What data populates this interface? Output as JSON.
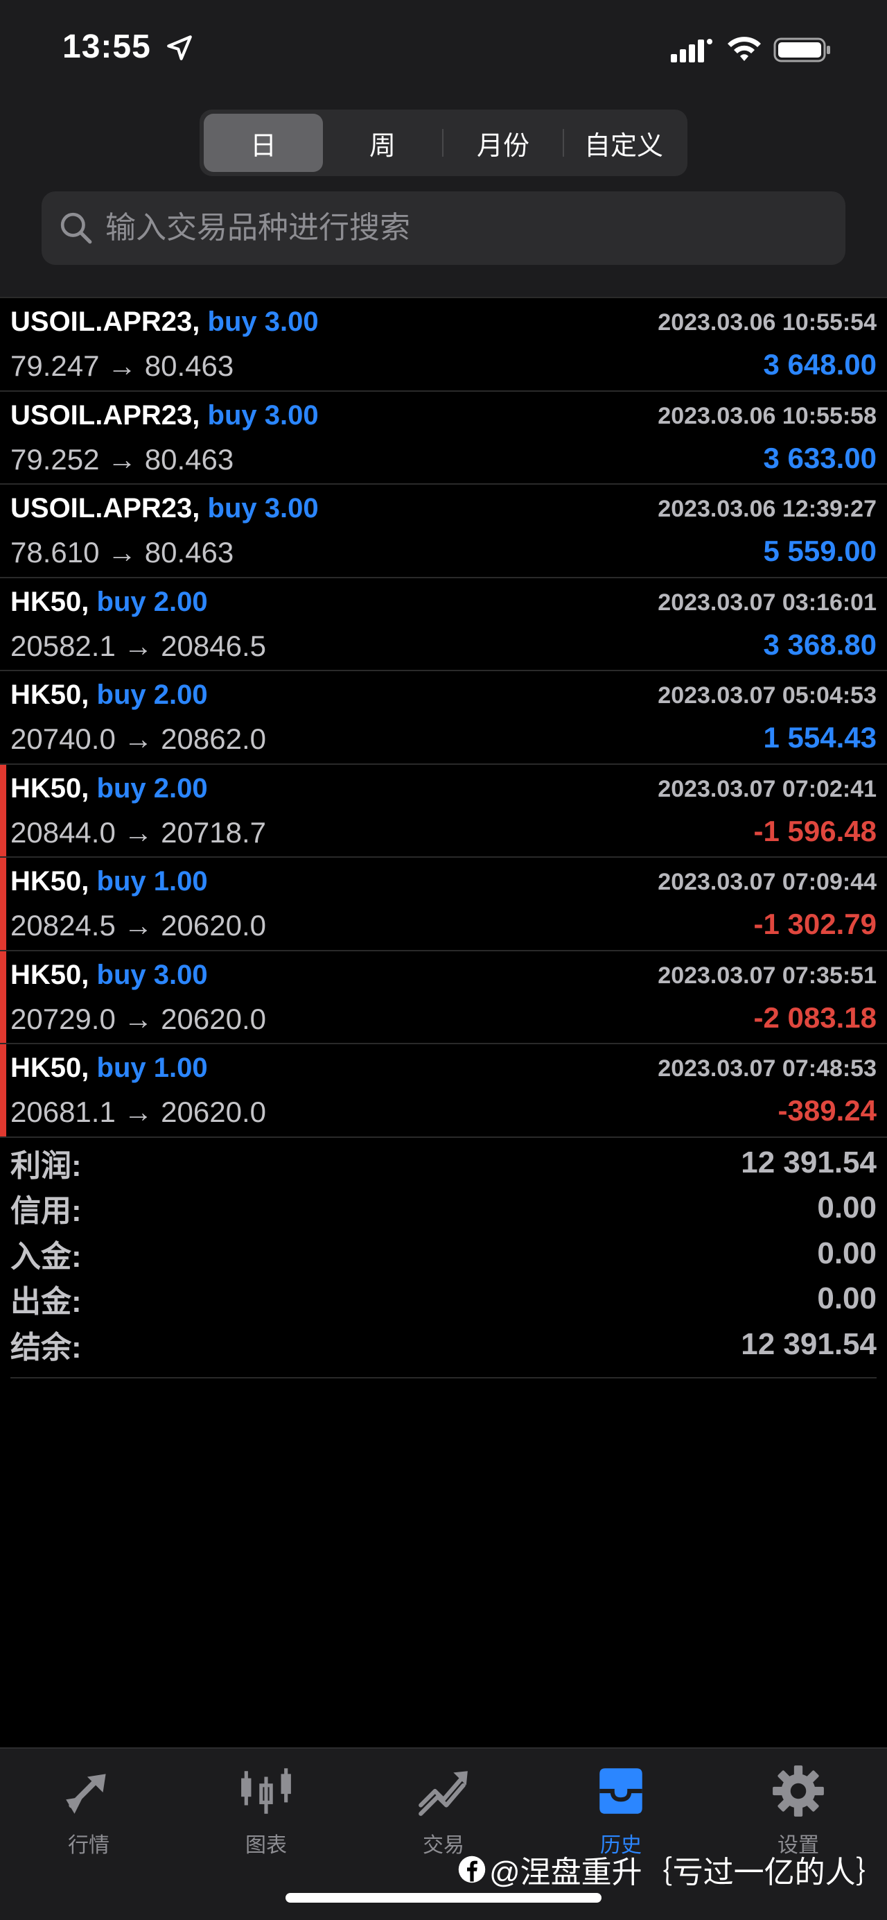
{
  "status": {
    "time": "13:55"
  },
  "periods": [
    "日",
    "周",
    "月份",
    "自定义"
  ],
  "active_period": "日",
  "search": {
    "placeholder": "输入交易品种进行搜索"
  },
  "deals": [
    {
      "symbol": "USOIL.APR23,",
      "side": "buy 3.00",
      "time": "2023.03.06 10:55:54",
      "prices": "79.247 → 80.463",
      "profit": "3 648.00",
      "profit_sign": "positive"
    },
    {
      "symbol": "USOIL.APR23,",
      "side": "buy 3.00",
      "time": "2023.03.06 10:55:58",
      "prices": "79.252 → 80.463",
      "profit": "3 633.00",
      "profit_sign": "positive"
    },
    {
      "symbol": "USOIL.APR23,",
      "side": "buy 3.00",
      "time": "2023.03.06 12:39:27",
      "prices": "78.610 → 80.463",
      "profit": "5 559.00",
      "profit_sign": "positive"
    },
    {
      "symbol": "HK50,",
      "side": "buy 2.00",
      "time": "2023.03.07 03:16:01",
      "prices": "20582.1 → 20846.5",
      "profit": "3 368.80",
      "profit_sign": "positive"
    },
    {
      "symbol": "HK50,",
      "side": "buy 2.00",
      "time": "2023.03.07 05:04:53",
      "prices": "20740.0 → 20862.0",
      "profit": "1 554.43",
      "profit_sign": "positive"
    },
    {
      "symbol": "HK50,",
      "side": "buy 2.00",
      "time": "2023.03.07 07:02:41",
      "prices": "20844.0 → 20718.7",
      "profit": "-1 596.48",
      "profit_sign": "negative"
    },
    {
      "symbol": "HK50,",
      "side": "buy 1.00",
      "time": "2023.03.07 07:09:44",
      "prices": "20824.5 → 20620.0",
      "profit": "-1 302.79",
      "profit_sign": "negative"
    },
    {
      "symbol": "HK50,",
      "side": "buy 3.00",
      "time": "2023.03.07 07:35:51",
      "prices": "20729.0 → 20620.0",
      "profit": "-2 083.18",
      "profit_sign": "negative"
    },
    {
      "symbol": "HK50,",
      "side": "buy 1.00",
      "time": "2023.03.07 07:48:53",
      "prices": "20681.1 → 20620.0",
      "profit": "-389.24",
      "profit_sign": "negative"
    }
  ],
  "summary": [
    {
      "label": "利润:",
      "value": "12 391.54"
    },
    {
      "label": "信用:",
      "value": "0.00"
    },
    {
      "label": "入金:",
      "value": "0.00"
    },
    {
      "label": "出金:",
      "value": "0.00"
    },
    {
      "label": "结余:",
      "value": "12 391.54"
    }
  ],
  "tabs": [
    {
      "label": "行情",
      "icon": "quotes-arrows-icon"
    },
    {
      "label": "图表",
      "icon": "candlestick-chart-icon"
    },
    {
      "label": "交易",
      "icon": "trade-trend-icon"
    },
    {
      "label": "历史",
      "icon": "history-inbox-icon"
    },
    {
      "label": "设置",
      "icon": "gear-icon"
    }
  ],
  "active_tab": "历史",
  "watermark": "@涅盘重升｛亏过一亿的人｝",
  "colors": {
    "accent": "#2b86ff",
    "loss": "#e0473e",
    "background": "#000000",
    "panel": "#1c1c1e"
  }
}
